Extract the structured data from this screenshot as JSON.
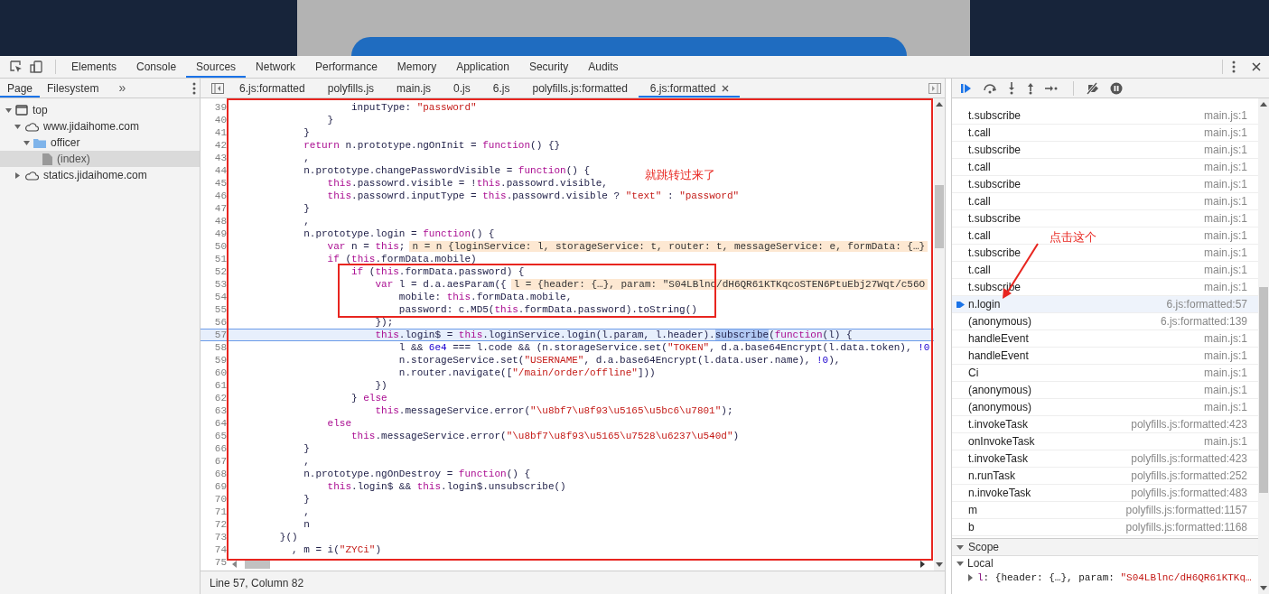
{
  "devtools": {
    "tabs": [
      {
        "label": "Elements",
        "selected": false
      },
      {
        "label": "Console",
        "selected": false
      },
      {
        "label": "Sources",
        "selected": true
      },
      {
        "label": "Network",
        "selected": false
      },
      {
        "label": "Performance",
        "selected": false
      },
      {
        "label": "Memory",
        "selected": false
      },
      {
        "label": "Application",
        "selected": false
      },
      {
        "label": "Security",
        "selected": false
      },
      {
        "label": "Audits",
        "selected": false
      }
    ]
  },
  "navigator": {
    "tabs": [
      {
        "label": "Page",
        "selected": true
      },
      {
        "label": "Filesystem",
        "selected": false
      }
    ],
    "more": "»",
    "tree": [
      {
        "label": "top",
        "kind": "frame",
        "expanded": true,
        "selected": false,
        "children": [
          {
            "label": "www.jidaihome.com",
            "kind": "domain",
            "expanded": true,
            "selected": false,
            "children": [
              {
                "label": "officer",
                "kind": "folder",
                "expanded": true,
                "selected": false,
                "children": [
                  {
                    "label": "(index)",
                    "kind": "file",
                    "selected": true
                  }
                ]
              }
            ]
          },
          {
            "label": "statics.jidaihome.com",
            "kind": "domain",
            "expanded": false,
            "selected": false
          }
        ]
      }
    ]
  },
  "editor": {
    "tabs": [
      {
        "label": "6.js:formatted",
        "selected": false
      },
      {
        "label": "polyfills.js",
        "selected": false
      },
      {
        "label": "main.js",
        "selected": false
      },
      {
        "label": "0.js",
        "selected": false
      },
      {
        "label": "6.js",
        "selected": false
      },
      {
        "label": "polyfills.js:formatted",
        "selected": false
      },
      {
        "label": "6.js:formatted",
        "selected": true
      }
    ],
    "lines": [
      {
        "number": "39",
        "current": false,
        "tokens": [
          {
            "kind": "plain",
            "text": "                    inputType: "
          },
          {
            "kind": "string",
            "text": "\"password\""
          }
        ]
      },
      {
        "number": "40",
        "current": false,
        "tokens": [
          {
            "kind": "plain",
            "text": "                }"
          }
        ]
      },
      {
        "number": "41",
        "current": false,
        "tokens": [
          {
            "kind": "plain",
            "text": "            }"
          }
        ]
      },
      {
        "number": "42",
        "current": false,
        "tokens": [
          {
            "kind": "keyword",
            "text": "            return"
          },
          {
            "kind": "plain",
            "text": " n.prototype.ngOnInit = "
          },
          {
            "kind": "keyword",
            "text": "function"
          },
          {
            "kind": "plain",
            "text": "() {}"
          }
        ]
      },
      {
        "number": "43",
        "current": false,
        "tokens": [
          {
            "kind": "plain",
            "text": "            ,"
          }
        ]
      },
      {
        "number": "44",
        "current": false,
        "tokens": [
          {
            "kind": "plain",
            "text": "            n.prototype.changePasswordVisible = "
          },
          {
            "kind": "keyword",
            "text": "function"
          },
          {
            "kind": "plain",
            "text": "() {"
          }
        ]
      },
      {
        "number": "45",
        "current": false,
        "tokens": [
          {
            "kind": "keyword",
            "text": "                this"
          },
          {
            "kind": "plain",
            "text": ".passowrd.visible = !"
          },
          {
            "kind": "keyword",
            "text": "this"
          },
          {
            "kind": "plain",
            "text": ".passowrd.visible,"
          }
        ]
      },
      {
        "number": "46",
        "current": false,
        "tokens": [
          {
            "kind": "keyword",
            "text": "                this"
          },
          {
            "kind": "plain",
            "text": ".passowrd.inputType = "
          },
          {
            "kind": "keyword",
            "text": "this"
          },
          {
            "kind": "plain",
            "text": ".passowrd.visible ? "
          },
          {
            "kind": "string",
            "text": "\"text\""
          },
          {
            "kind": "plain",
            "text": " : "
          },
          {
            "kind": "string",
            "text": "\"password\""
          }
        ]
      },
      {
        "number": "47",
        "current": false,
        "tokens": [
          {
            "kind": "plain",
            "text": "            }"
          }
        ]
      },
      {
        "number": "48",
        "current": false,
        "tokens": [
          {
            "kind": "plain",
            "text": "            ,"
          }
        ]
      },
      {
        "number": "49",
        "current": false,
        "tokens": [
          {
            "kind": "plain",
            "text": "            n.prototype.login = "
          },
          {
            "kind": "keyword",
            "text": "function"
          },
          {
            "kind": "plain",
            "text": "() {"
          }
        ]
      },
      {
        "number": "50",
        "current": false,
        "tokens": [
          {
            "kind": "keyword",
            "text": "                var"
          },
          {
            "kind": "plain",
            "text": " n = "
          },
          {
            "kind": "keyword",
            "text": "this"
          },
          {
            "kind": "plain",
            "text": ";"
          }
        ],
        "inline_value": "n = n {loginService: l, storageService: t, router: t, messageService: e, formData: {…}"
      },
      {
        "number": "51",
        "current": false,
        "tokens": [
          {
            "kind": "keyword",
            "text": "                if"
          },
          {
            "kind": "plain",
            "text": " ("
          },
          {
            "kind": "keyword",
            "text": "this"
          },
          {
            "kind": "plain",
            "text": ".formData.mobile)"
          }
        ]
      },
      {
        "number": "52",
        "current": false,
        "tokens": [
          {
            "kind": "keyword",
            "text": "                    if"
          },
          {
            "kind": "plain",
            "text": " ("
          },
          {
            "kind": "keyword",
            "text": "this"
          },
          {
            "kind": "plain",
            "text": ".formData.password) {"
          }
        ]
      },
      {
        "number": "53",
        "current": false,
        "tokens": [
          {
            "kind": "keyword",
            "text": "                        var"
          },
          {
            "kind": "plain",
            "text": " l = d.a.aesParam({"
          }
        ],
        "inline_value": "l = {header: {…}, param: \"S04LBlnc/dH6QR61KTKqcoSTEN6PtuEbj27Wqt/c56O"
      },
      {
        "number": "54",
        "current": false,
        "tokens": [
          {
            "kind": "plain",
            "text": "                            mobile: "
          },
          {
            "kind": "keyword",
            "text": "this"
          },
          {
            "kind": "plain",
            "text": ".formData.mobile,"
          }
        ]
      },
      {
        "number": "55",
        "current": false,
        "tokens": [
          {
            "kind": "plain",
            "text": "                            password: c.MD5("
          },
          {
            "kind": "keyword",
            "text": "this"
          },
          {
            "kind": "plain",
            "text": ".formData.password).toString()"
          }
        ]
      },
      {
        "number": "56",
        "current": false,
        "tokens": [
          {
            "kind": "plain",
            "text": "                        });"
          }
        ]
      },
      {
        "number": "57",
        "current": true,
        "tokens": [
          {
            "kind": "keyword",
            "text": "                        this"
          },
          {
            "kind": "plain",
            "text": ".login$ = "
          },
          {
            "kind": "keyword",
            "text": "this"
          },
          {
            "kind": "plain",
            "text": ".loginService.login(l.param, l.header)."
          },
          {
            "kind": "selection",
            "text": "subscribe"
          },
          {
            "kind": "plain",
            "text": "("
          },
          {
            "kind": "keyword",
            "text": "function"
          },
          {
            "kind": "plain",
            "text": "(l) {"
          }
        ]
      },
      {
        "number": "58",
        "current": false,
        "tokens": [
          {
            "kind": "plain",
            "text": "                            l && "
          },
          {
            "kind": "number",
            "text": "6e4"
          },
          {
            "kind": "plain",
            "text": " === l.code && (n.storageService.set("
          },
          {
            "kind": "string",
            "text": "\"TOKEN\""
          },
          {
            "kind": "plain",
            "text": ", d.a.base64Encrypt(l.data.token), "
          },
          {
            "kind": "number",
            "text": "!0"
          }
        ]
      },
      {
        "number": "59",
        "current": false,
        "tokens": [
          {
            "kind": "plain",
            "text": "                            n.storageService.set("
          },
          {
            "kind": "string",
            "text": "\"USERNAME\""
          },
          {
            "kind": "plain",
            "text": ", d.a.base64Encrypt(l.data.user.name), "
          },
          {
            "kind": "number",
            "text": "!0"
          },
          {
            "kind": "plain",
            "text": "),"
          }
        ]
      },
      {
        "number": "60",
        "current": false,
        "tokens": [
          {
            "kind": "plain",
            "text": "                            n.router.navigate(["
          },
          {
            "kind": "string",
            "text": "\"/main/order/offline\""
          },
          {
            "kind": "plain",
            "text": "]))"
          }
        ]
      },
      {
        "number": "61",
        "current": false,
        "tokens": [
          {
            "kind": "plain",
            "text": "                        })"
          }
        ]
      },
      {
        "number": "62",
        "current": false,
        "tokens": [
          {
            "kind": "plain",
            "text": "                    } "
          },
          {
            "kind": "keyword",
            "text": "else"
          }
        ]
      },
      {
        "number": "63",
        "current": false,
        "tokens": [
          {
            "kind": "keyword",
            "text": "                        this"
          },
          {
            "kind": "plain",
            "text": ".messageService.error("
          },
          {
            "kind": "string",
            "text": "\"\\u8bf7\\u8f93\\u5165\\u5bc6\\u7801\""
          },
          {
            "kind": "plain",
            "text": ");"
          }
        ]
      },
      {
        "number": "64",
        "current": false,
        "tokens": [
          {
            "kind": "keyword",
            "text": "                else"
          }
        ]
      },
      {
        "number": "65",
        "current": false,
        "tokens": [
          {
            "kind": "keyword",
            "text": "                    this"
          },
          {
            "kind": "plain",
            "text": ".messageService.error("
          },
          {
            "kind": "string",
            "text": "\"\\u8bf7\\u8f93\\u5165\\u7528\\u6237\\u540d\""
          },
          {
            "kind": "plain",
            "text": ")"
          }
        ]
      },
      {
        "number": "66",
        "current": false,
        "tokens": [
          {
            "kind": "plain",
            "text": "            }"
          }
        ]
      },
      {
        "number": "67",
        "current": false,
        "tokens": [
          {
            "kind": "plain",
            "text": "            ,"
          }
        ]
      },
      {
        "number": "68",
        "current": false,
        "tokens": [
          {
            "kind": "plain",
            "text": "            n.prototype.ngOnDestroy = "
          },
          {
            "kind": "keyword",
            "text": "function"
          },
          {
            "kind": "plain",
            "text": "() {"
          }
        ]
      },
      {
        "number": "69",
        "current": false,
        "tokens": [
          {
            "kind": "keyword",
            "text": "                this"
          },
          {
            "kind": "plain",
            "text": ".login$ && "
          },
          {
            "kind": "keyword",
            "text": "this"
          },
          {
            "kind": "plain",
            "text": ".login$.unsubscribe()"
          }
        ]
      },
      {
        "number": "70",
        "current": false,
        "tokens": [
          {
            "kind": "plain",
            "text": "            }"
          }
        ]
      },
      {
        "number": "71",
        "current": false,
        "tokens": [
          {
            "kind": "plain",
            "text": "            ,"
          }
        ]
      },
      {
        "number": "72",
        "current": false,
        "tokens": [
          {
            "kind": "plain",
            "text": "            n"
          }
        ]
      },
      {
        "number": "73",
        "current": false,
        "tokens": [
          {
            "kind": "plain",
            "text": "        }()"
          }
        ]
      },
      {
        "number": "74",
        "current": false,
        "tokens": [
          {
            "kind": "plain",
            "text": "          , m = i("
          },
          {
            "kind": "string",
            "text": "\"ZYCi\""
          },
          {
            "kind": "plain",
            "text": ")"
          }
        ]
      },
      {
        "number": "75",
        "current": false
      }
    ],
    "status": "Line 57, Column 82"
  },
  "call_stack": {
    "frames": [
      {
        "name": "t.subscribe",
        "location": "main.js:1",
        "selected": false
      },
      {
        "name": "t.call",
        "location": "main.js:1",
        "selected": false
      },
      {
        "name": "t.subscribe",
        "location": "main.js:1",
        "selected": false
      },
      {
        "name": "t.call",
        "location": "main.js:1",
        "selected": false
      },
      {
        "name": "t.subscribe",
        "location": "main.js:1",
        "selected": false
      },
      {
        "name": "t.call",
        "location": "main.js:1",
        "selected": false
      },
      {
        "name": "t.subscribe",
        "location": "main.js:1",
        "selected": false
      },
      {
        "name": "t.call",
        "location": "main.js:1",
        "selected": false
      },
      {
        "name": "t.subscribe",
        "location": "main.js:1",
        "selected": false
      },
      {
        "name": "t.call",
        "location": "main.js:1",
        "selected": false
      },
      {
        "name": "t.subscribe",
        "location": "main.js:1",
        "selected": false
      },
      {
        "name": "n.login",
        "location": "6.js:formatted:57",
        "selected": true
      },
      {
        "name": "(anonymous)",
        "location": "6.js:formatted:139",
        "selected": false
      },
      {
        "name": "handleEvent",
        "location": "main.js:1",
        "selected": false
      },
      {
        "name": "handleEvent",
        "location": "main.js:1",
        "selected": false
      },
      {
        "name": "Ci",
        "location": "main.js:1",
        "selected": false
      },
      {
        "name": "(anonymous)",
        "location": "main.js:1",
        "selected": false
      },
      {
        "name": "(anonymous)",
        "location": "main.js:1",
        "selected": false
      },
      {
        "name": "t.invokeTask",
        "location": "polyfills.js:formatted:423",
        "selected": false
      },
      {
        "name": "onInvokeTask",
        "location": "main.js:1",
        "selected": false
      },
      {
        "name": "t.invokeTask",
        "location": "polyfills.js:formatted:423",
        "selected": false
      },
      {
        "name": "n.runTask",
        "location": "polyfills.js:formatted:252",
        "selected": false
      },
      {
        "name": "n.invokeTask",
        "location": "polyfills.js:formatted:483",
        "selected": false
      },
      {
        "name": "m",
        "location": "polyfills.js:formatted:1157",
        "selected": false
      },
      {
        "name": "b",
        "location": "polyfills.js:formatted:1168",
        "selected": false
      }
    ]
  },
  "scope": {
    "title": "Scope",
    "expanded": true,
    "sections": [
      {
        "title": "Local",
        "expanded": true,
        "vars": [
          {
            "expanded": false,
            "tokens": [
              {
                "kind": "name",
                "text": "l"
              },
              {
                "kind": "plain",
                "text": ": {header: {…}, param: "
              },
              {
                "kind": "string",
                "text": "\"S04LBlnc/dH6QR61KTKq…"
              }
            ]
          }
        ]
      }
    ]
  },
  "annotations": [
    {
      "text": "就跳转过来了"
    },
    {
      "text": "点击这个"
    }
  ]
}
